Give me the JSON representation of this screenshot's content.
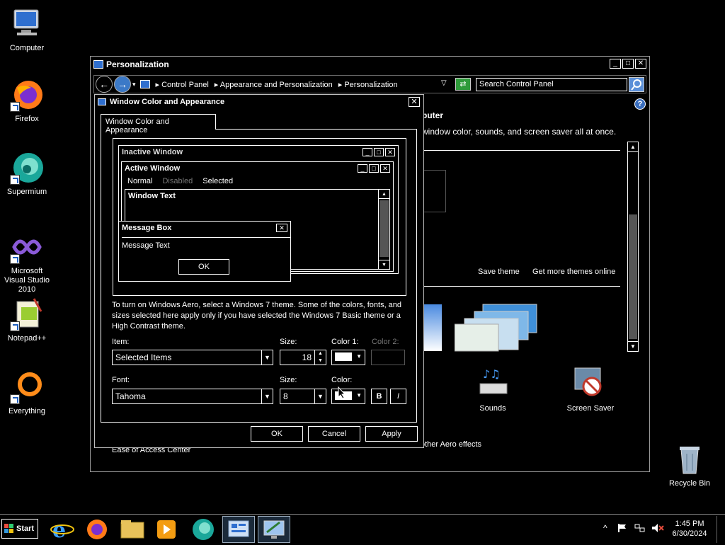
{
  "desktop_icons": [
    {
      "label": "Computer",
      "icon": "computer-icon"
    },
    {
      "label": "Firefox",
      "icon": "firefox-icon"
    },
    {
      "label": "Supermium",
      "icon": "supermium-icon"
    },
    {
      "label": "Microsoft Visual Studio 2010",
      "icon": "visual-studio-icon"
    },
    {
      "label": "Notepad++",
      "icon": "notepadpp-icon"
    },
    {
      "label": "Everything",
      "icon": "everything-icon"
    },
    {
      "label": "Recycle Bin",
      "icon": "recycle-bin-icon"
    }
  ],
  "main_window": {
    "title": "Personalization",
    "breadcrumb": [
      "Control Panel",
      "Appearance and Personalization",
      "Personalization"
    ],
    "search_placeholder": "Search Control Panel",
    "heading_partial": "puter",
    "desc_partial": "window color, sounds, and screen saver all at once.",
    "save_theme": "Save theme",
    "get_more_themes": "Get more themes online",
    "sounds_label": "Sounds",
    "screen_saver_label": "Screen Saver",
    "aero_partial": "other Aero effects",
    "ease_partial": "Ease of Access Center"
  },
  "dialog": {
    "title": "Window Color and Appearance",
    "tab_label": "Window Color and Appearance",
    "preview": {
      "inactive_title": "Inactive Window",
      "active_title": "Active Window",
      "menu_normal": "Normal",
      "menu_disabled": "Disabled",
      "menu_selected": "Selected",
      "window_text": "Window Text",
      "msgbox_title": "Message Box",
      "msgbox_text": "Message Text",
      "msgbox_ok": "OK"
    },
    "info_text": "To turn on Windows Aero, select a Windows 7 theme.  Some of the colors, fonts, and sizes selected here apply only if you have selected the Windows 7 Basic theme or a High Contrast theme.",
    "item_label": "Item:",
    "item_value": "Selected Items",
    "size_label": "Size:",
    "size_value": "18",
    "color1_label": "Color 1:",
    "color2_label": "Color 2:",
    "font_label": "Font:",
    "font_value": "Tahoma",
    "font_size_label": "Size:",
    "font_size_value": "8",
    "font_color_label": "Color:",
    "bold_label": "B",
    "italic_label": "I",
    "ok_label": "OK",
    "cancel_label": "Cancel",
    "apply_label": "Apply"
  },
  "taskbar": {
    "start_label": "Start",
    "time": "1:45 PM",
    "date": "6/30/2024",
    "apps": [
      "internet-explorer-icon",
      "firefox-icon",
      "file-explorer-icon",
      "media-player-icon",
      "supermium-icon",
      "control-panel-icon",
      "display-settings-icon"
    ]
  },
  "colors": {
    "accent": "#3b79c7",
    "background": "#000000",
    "foreground": "#ffffff"
  }
}
